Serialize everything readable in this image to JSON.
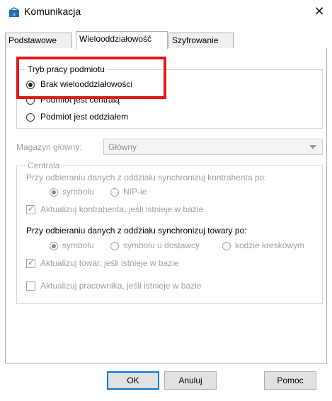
{
  "window": {
    "title": "Komunikacja",
    "close_glyph": "✕",
    "icon": "app-icon"
  },
  "tabs": [
    {
      "label": "Podstawowe",
      "active": false
    },
    {
      "label": "Wielooddziałowość",
      "active": true
    },
    {
      "label": "Szyfrowanie",
      "active": false
    }
  ],
  "mode_group": {
    "legend": "Tryb pracy podmiotu",
    "options": [
      {
        "label": "Brak wielooddziałowości",
        "selected": true
      },
      {
        "label": "Podmiot jest centralą",
        "selected": false
      },
      {
        "label": "Podmiot jest oddziałem",
        "selected": false
      }
    ]
  },
  "warehouse": {
    "label": "Magazyn główny:",
    "value": "Główny"
  },
  "central_group": {
    "legend": "Centrala",
    "contractor_sync_label": "Przy odbieraniu danych z oddziału synchronizuj kontrahenta po:",
    "contractor_options": [
      {
        "label": "symbolu",
        "selected": true
      },
      {
        "label": "NIP-ie",
        "selected": false
      }
    ],
    "update_contractor": {
      "label": "Aktualizuj kontrahenta, jeśli istnieje w bazie",
      "checked": true
    },
    "goods_sync_label": "Przy odbieraniu danych z oddziału synchronizuj towary po:",
    "goods_options": [
      {
        "label": "symbolu",
        "selected": true
      },
      {
        "label": "symbolu u dostawcy",
        "selected": false
      },
      {
        "label": "kodzie kreskowym",
        "selected": false
      }
    ],
    "update_goods": {
      "label": "Aktualizuj towar, jeśli istnieje w bazie",
      "checked": true
    },
    "update_employee": {
      "label": "Aktualizuj pracownika, jeśli istnieje w bazie",
      "checked": false
    }
  },
  "buttons": {
    "ok": "OK",
    "cancel": "Anuluj",
    "help": "Pomoc"
  },
  "colors": {
    "highlight": "#e01818",
    "focus": "#0078d7",
    "disabled_text": "#a0a0a0"
  }
}
